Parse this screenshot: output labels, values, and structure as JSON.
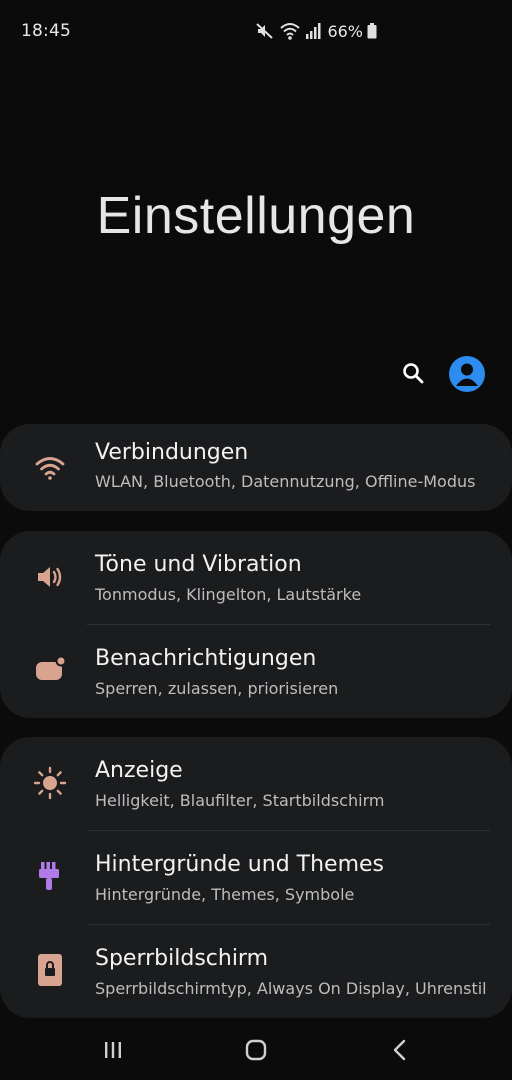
{
  "status_bar": {
    "time": "18:45",
    "battery": "66%",
    "icons": [
      "mute-icon",
      "wifi-icon",
      "signal-icon",
      "battery-icon"
    ]
  },
  "header": {
    "title": "Einstellungen"
  },
  "actions": {
    "icons": [
      "search-icon",
      "account-icon"
    ],
    "account_color": "#2d8cf0"
  },
  "groups": [
    {
      "items": [
        {
          "title": "Verbindungen",
          "subtitle": "WLAN, Bluetooth, Datennutzung, Offline-Modus",
          "icon": "wifi-icon"
        }
      ]
    },
    {
      "items": [
        {
          "title": "Töne und Vibration",
          "subtitle": "Tonmodus, Klingelton, Lautstärke",
          "icon": "speaker-icon"
        },
        {
          "title": "Benachrichtigungen",
          "subtitle": "Sperren, zulassen, priorisieren",
          "icon": "notification-icon"
        }
      ]
    },
    {
      "items": [
        {
          "title": "Anzeige",
          "subtitle": "Helligkeit, Blaufilter, Startbildschirm",
          "icon": "brightness-icon"
        },
        {
          "title": "Hintergründe und Themes",
          "subtitle": "Hintergründe, Themes, Symbole",
          "icon": "paintbrush-icon"
        },
        {
          "title": "Sperrbildschirm",
          "subtitle": "Sperrbildschirmtyp, Always On Display, Uhrenstil",
          "icon": "lock-icon"
        }
      ]
    }
  ],
  "colors": {
    "background": "#0b0b0c",
    "card": "#1b1c1e",
    "icon_peach": "#d9a48f",
    "icon_purple": "#b07be6",
    "accent_blue": "#2d8cf0"
  },
  "navigation_bar": {
    "icons": [
      "recent-apps-icon",
      "home-icon",
      "back-icon"
    ]
  }
}
